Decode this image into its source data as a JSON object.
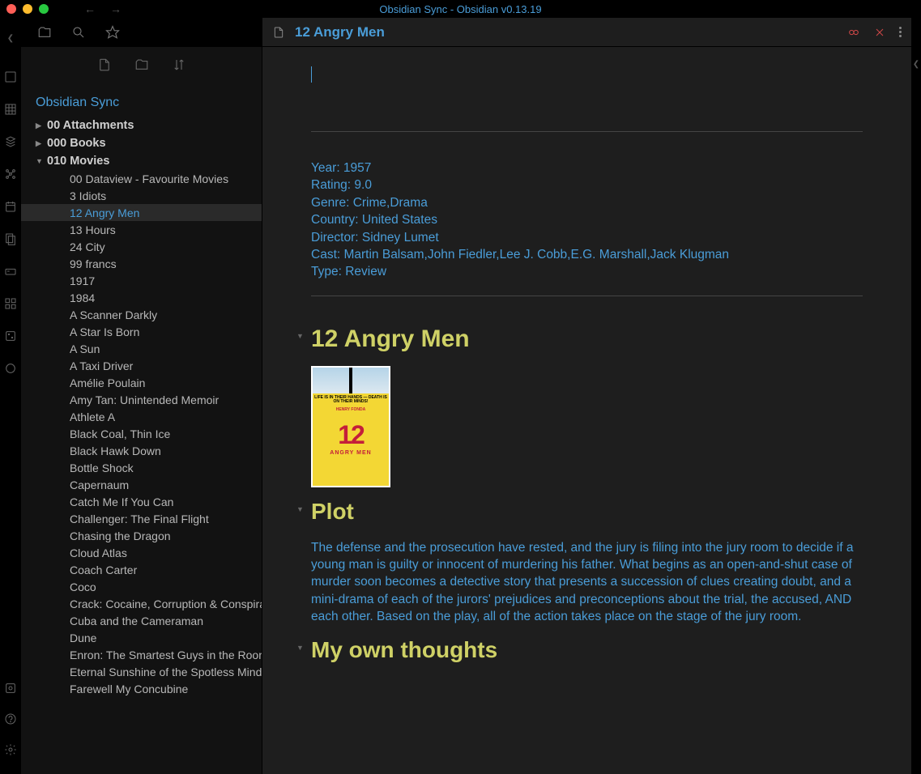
{
  "app": {
    "title": "Obsidian Sync - Obsidian v0.13.19",
    "vault_name": "Obsidian Sync"
  },
  "tree": {
    "folders": [
      {
        "name": "00 Attachments",
        "expanded": false
      },
      {
        "name": "000 Books",
        "expanded": false
      },
      {
        "name": "010 Movies",
        "expanded": true
      }
    ],
    "files": [
      "00 Dataview - Favourite Movies",
      "3 Idiots",
      "12 Angry Men",
      "13 Hours",
      "24 City",
      "99 francs",
      "1917",
      "1984",
      "A Scanner Darkly",
      "A Star Is Born",
      "A Sun",
      "A Taxi Driver",
      "Amélie Poulain",
      "Amy Tan: Unintended Memoir",
      "Athlete A",
      "Black Coal, Thin Ice",
      "Black Hawk Down",
      "Bottle Shock",
      "Capernaum",
      "Catch Me If You Can",
      "Challenger: The Final Flight",
      "Chasing the Dragon",
      "Cloud Atlas",
      "Coach Carter",
      "Coco",
      "Crack: Cocaine, Corruption & Conspiracy",
      "Cuba and the Cameraman",
      "Dune",
      "Enron: The Smartest Guys in the Room",
      "Eternal Sunshine of the Spotless Mind",
      "Farewell My Concubine"
    ],
    "active_file": "12 Angry Men"
  },
  "note": {
    "title": "12 Angry Men",
    "meta": {
      "year": "Year: 1957",
      "rating": "Rating: 9.0",
      "genre": "Genre: Crime,Drama",
      "country": "Country: United States",
      "director": "Director: Sidney Lumet",
      "cast": "Cast: Martin Balsam,John Fiedler,Lee J. Cobb,E.G. Marshall,Jack Klugman",
      "type": "Type: Review"
    },
    "heading1": "12 Angry Men",
    "heading2": "Plot",
    "plot": "The defense and the prosecution have rested, and the jury is filing into the jury room to decide if a young man is guilty or innocent of murdering his father. What begins as an open-and-shut case of murder soon becomes a detective story that presents a succession of clues creating doubt, and a mini-drama of each of the jurors' prejudices and preconceptions about the trial, the accused, AND each other. Based on the play, all of the action takes place on the stage of the jury room.",
    "heading3": "My own thoughts",
    "poster": {
      "tagline": "LIFE IS IN THEIR HANDS — DEATH IS ON THEIR MINDS!",
      "star": "HENRY FONDA",
      "big": "12",
      "sub": "ANGRY MEN"
    }
  }
}
